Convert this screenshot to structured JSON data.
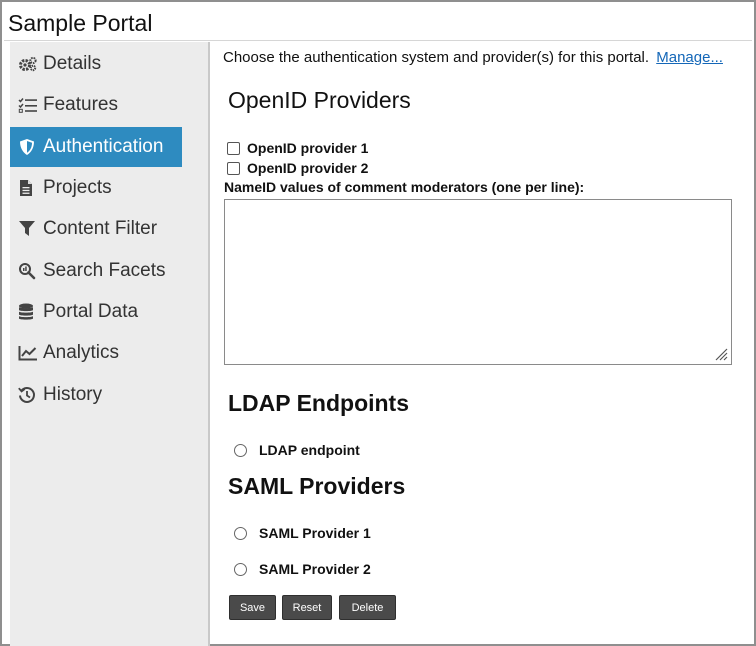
{
  "app": {
    "title": "Sample Portal"
  },
  "sidebar": {
    "items": [
      {
        "label": "Details",
        "icon": "gears-icon"
      },
      {
        "label": "Features",
        "icon": "checklist-icon"
      },
      {
        "label": "Authentication",
        "icon": "shield-icon",
        "active": true
      },
      {
        "label": "Projects",
        "icon": "document-icon"
      },
      {
        "label": "Content Filter",
        "icon": "filter-icon"
      },
      {
        "label": "Search Facets",
        "icon": "search-facets-icon"
      },
      {
        "label": "Portal Data",
        "icon": "database-icon"
      },
      {
        "label": "Analytics",
        "icon": "line-chart-icon"
      },
      {
        "label": "History",
        "icon": "history-icon"
      }
    ]
  },
  "main": {
    "intro": "Choose the authentication system and provider(s) for this portal.",
    "manage_link": "Manage...",
    "openid": {
      "heading": "OpenID Providers",
      "providers": [
        "OpenID provider 1",
        "OpenID provider 2"
      ],
      "moderators_label": "NameID values of comment moderators (one per line):",
      "moderators_value": ""
    },
    "ldap": {
      "heading": "LDAP Endpoints",
      "endpoints": [
        "LDAP endpoint"
      ]
    },
    "saml": {
      "heading": "SAML Providers",
      "providers": [
        "SAML Provider 1",
        "SAML Provider 2"
      ]
    },
    "buttons": {
      "save": "Save",
      "reset": "Reset",
      "delete": "Delete"
    }
  },
  "colors": {
    "accent": "#2e8bc0",
    "link": "#1467b8",
    "button": "#4a4a4a",
    "sidebar_bg": "#ececec"
  }
}
